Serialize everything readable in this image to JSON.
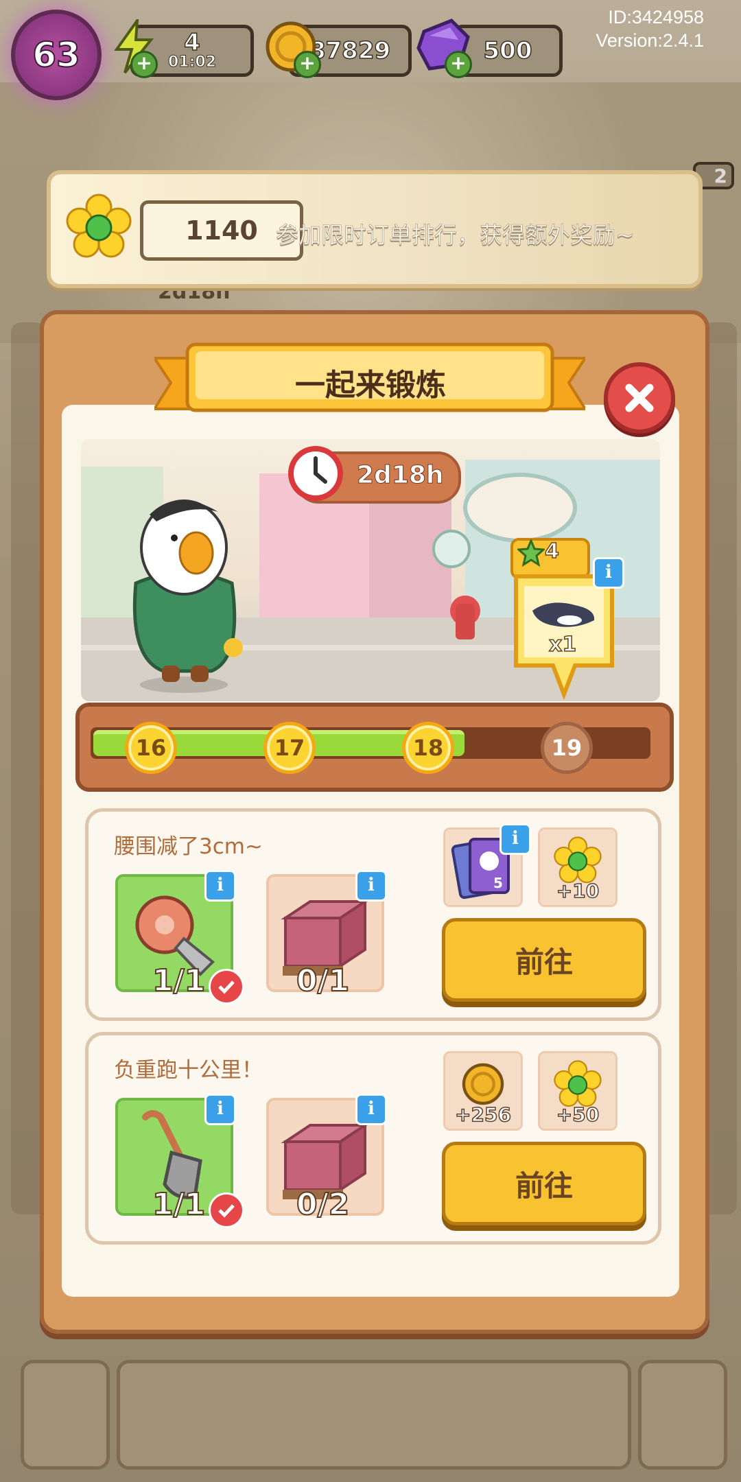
{
  "hud": {
    "level": "63",
    "energy": "4",
    "energy_timer": "01:02",
    "coins": "87829",
    "gems": "500",
    "player_id": "ID:3424958",
    "version": "Version:2.4.1"
  },
  "banner": {
    "score": "1140",
    "text": "参加限时订单排行，获得额外奖励~"
  },
  "background": {
    "left_timer": "2d18h",
    "right_count": "2"
  },
  "event": {
    "title": "一起来锻炼",
    "timer": "2d18h",
    "reward_points": "4",
    "reward_count": "x1",
    "reward_icon": "orca-icon"
  },
  "progress": {
    "fraction": 0.67,
    "milestones": [
      {
        "label": "16",
        "reached": true
      },
      {
        "label": "17",
        "reached": true
      },
      {
        "label": "18",
        "reached": true
      },
      {
        "label": "19",
        "reached": false
      }
    ]
  },
  "tasks": [
    {
      "label": "腰围减了3cm~",
      "items": [
        {
          "icon": "tape-measure-icon",
          "count": "1/1",
          "done": true
        },
        {
          "icon": "brick-pallet-icon",
          "count": "0/1",
          "done": false
        }
      ],
      "rewards": [
        {
          "icon": "card-pack-icon",
          "text": "5"
        },
        {
          "icon": "gem-flower-icon",
          "text": "+10"
        }
      ],
      "button": "前往"
    },
    {
      "label": "负重跑十公里！",
      "items": [
        {
          "icon": "shovel-icon",
          "count": "1/1",
          "done": true
        },
        {
          "icon": "brick-pallet-icon",
          "count": "0/2",
          "done": false
        }
      ],
      "rewards": [
        {
          "icon": "coin-icon",
          "text": "+256"
        },
        {
          "icon": "gem-flower-icon",
          "text": "+50"
        }
      ],
      "button": "前往"
    }
  ],
  "colors": {
    "panel": "#d89b60",
    "button": "#f8c231",
    "progress_fill": "#9ad93a",
    "close": "#e34d4a"
  }
}
